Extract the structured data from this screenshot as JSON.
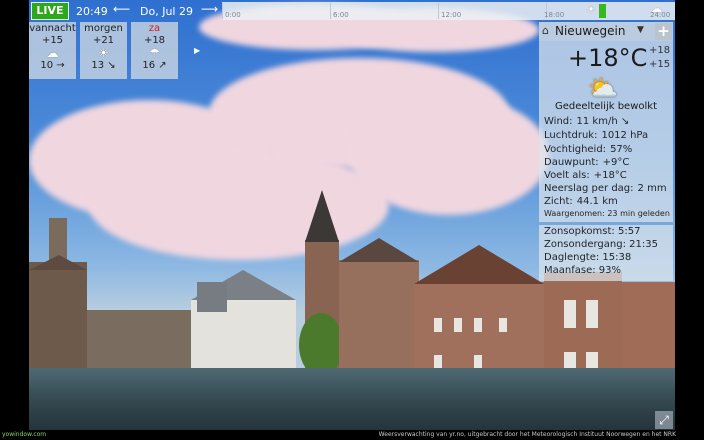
{
  "topbar": {
    "live_label": "LIVE",
    "time": "20:49",
    "prev_icon": "left-arrow-icon",
    "date": "Do, Jul 29",
    "next_icon": "right-arrow-icon",
    "timeline_ticks": [
      "0:00",
      "6:00",
      "12:00",
      "18:00",
      "24:00"
    ]
  },
  "forecast": [
    {
      "name": "vannacht",
      "temp": "+15",
      "icon": "cloud-icon",
      "glyph": "☁",
      "wind": "10 →",
      "weekend": false
    },
    {
      "name": "morgen",
      "temp": "+21",
      "icon": "sun-icon",
      "glyph": "☀",
      "wind": "13 ↘",
      "weekend": false
    },
    {
      "name": "za",
      "temp": "+18",
      "icon": "rain-cloud-icon",
      "glyph": "☂",
      "wind": "16 ↗",
      "weekend": true
    }
  ],
  "forecast_more_icon": "chevron-right-icon",
  "current": {
    "city": "Nieuwegein",
    "temp": "+18°C",
    "high": "+18",
    "low": "+15",
    "condition_icon": "partly-cloudy-icon",
    "condition": "Gedeeltelijk bewolkt",
    "details": [
      {
        "label": "Wind:",
        "value": "11 km/h ↘"
      },
      {
        "label": "Luchtdruk:",
        "value": "1012 hPa"
      },
      {
        "label": "Vochtigheid:",
        "value": "57%"
      },
      {
        "label": "Dauwpunt:",
        "value": "+9°C"
      },
      {
        "label": "Voelt als:",
        "value": "+18°C"
      },
      {
        "label": "Neerslag per dag:",
        "value": "2 mm"
      },
      {
        "label": "Zicht:",
        "value": "44.1 km"
      }
    ],
    "observed": "Waargenomen: 23 min geleden"
  },
  "sun": [
    {
      "label": "Zonsopkomst:",
      "value": "5:57"
    },
    {
      "label": "Zonsondergang:",
      "value": "21:35"
    },
    {
      "label": "Daglengte:",
      "value": "15:38"
    },
    {
      "label": "Maanfase:",
      "value": "93%"
    }
  ],
  "footer": {
    "site": "yowindow.com",
    "credit": "Weersverwachting van yr.no, uitgebracht door het Meteorologisch Instituut Noorwegen en het NRK"
  },
  "fullscreen_icon": "fullscreen-icon"
}
